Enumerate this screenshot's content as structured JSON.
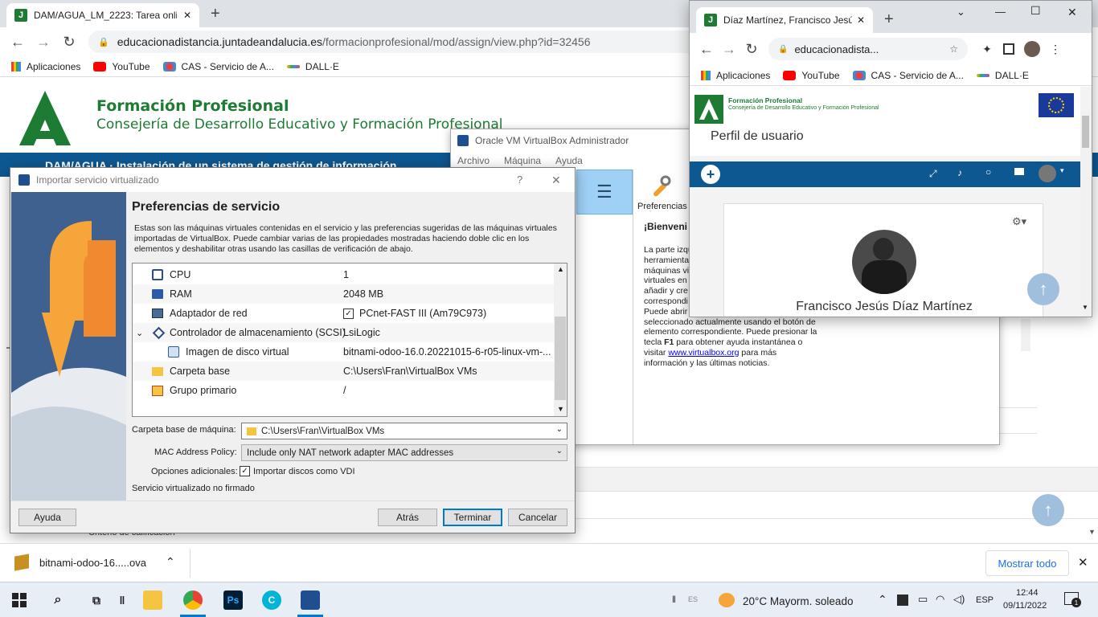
{
  "chrome_main": {
    "tab_title": "DAM/AGUA_LM_2223: Tarea onlin",
    "tab_close": "✕",
    "new_tab": "+",
    "url_host": "educacionadistancia.juntadeandalucia.es",
    "url_path": "/formacionprofesional/mod/assign/view.php?id=32456",
    "bookmarks": [
      "Aplicaciones",
      "YouTube",
      "CAS - Servicio de A...",
      "DALL·E"
    ]
  },
  "page": {
    "title": "Formación Profesional",
    "subtitle": "Consejería de Desarrollo Educativo y Formación Profesional",
    "banner": "DAM/AGUA · Instalación de un sistema de gestión de información",
    "criterio": "Criterio de calificación"
  },
  "vbox_manager": {
    "title": "Oracle VM VirtualBox Administrador",
    "menu": [
      "Archivo",
      "Máquina",
      "Ayuda"
    ],
    "preferences_label": "Preferencias",
    "welcome_heading": "¡Bienveni",
    "welcome_lines": [
      "La parte izqu",
      "herramienta",
      "máquinas vi",
      "virtuales en",
      "añadir y cre",
      "correspondi",
      "Puede abrir"
    ],
    "welcome_full": [
      "seleccionado actualmente usando el botón de",
      "elemento correspondiente. Puede presionar la"
    ],
    "f1_prefix": "tecla ",
    "f1_key": "F1",
    "f1_suffix": " para obtener ayuda instantánea o",
    "visit_prefix": "visitar ",
    "link": "www.virtualbox.org",
    "visit_suffix": " para más",
    "last_line": "información y las últimas noticias."
  },
  "dialog": {
    "title": "Importar servicio virtualizado",
    "help_glyph": "?",
    "close_glyph": "✕",
    "heading": "Preferencias de servicio",
    "description": "Estas son las máquinas virtuales contenidas en el servicio y las preferencias sugeridas de las máquinas virtuales importadas de VirtualBox. Puede cambiar varias de las propiedades mostradas haciendo doble clic en los elementos y deshabilitar otras usando las casillas de verificación de abajo.",
    "rows": [
      {
        "label": "CPU",
        "value": "1",
        "icon": "cpu-icon"
      },
      {
        "label": "RAM",
        "value": "2048 MB",
        "icon": "ram-icon"
      },
      {
        "label": "Adaptador de red",
        "value": "PCnet-FAST III (Am79C973)",
        "icon": "network-icon"
      },
      {
        "label": "Controlador de almacenamiento (SCSI)",
        "value": "LsiLogic",
        "icon": "storage-icon"
      },
      {
        "label": "Imagen de disco virtual",
        "value": "bitnami-odoo-16.0.20221015-6-r05-linux-vm-...",
        "icon": "disk-icon"
      },
      {
        "label": "Carpeta base",
        "value": "C:\\Users\\Fran\\VirtualBox VMs",
        "icon": "folder-icon"
      },
      {
        "label": "Grupo primario",
        "value": "/",
        "icon": "group-icon"
      }
    ],
    "machine_folder_label": "Carpeta base de máquina:",
    "machine_folder_value": "C:\\Users\\Fran\\VirtualBox VMs",
    "mac_policy_label": "MAC Address Policy:",
    "mac_policy_value": "Include only NAT network adapter MAC addresses",
    "additional_label": "Opciones adicionales:",
    "import_vdi_label": "Importar discos como VDI",
    "unsigned": "Servicio virtualizado no firmado",
    "btn_help": "Ayuda",
    "btn_back": "Atrás",
    "btn_finish": "Terminar",
    "btn_cancel": "Cancelar"
  },
  "chrome_second": {
    "tab_title": "Díaz Martínez, Francisco Jesús",
    "tab_close": "✕",
    "new_tab": "+",
    "url": "educacionadista...",
    "bookmarks": [
      "Aplicaciones",
      "YouTube",
      "CAS - Servicio de A...",
      "DALL·E"
    ],
    "fp_title": "Formación Profesional",
    "fp_sub": "Consejería de Desarrollo Educativo y Formación Profesional",
    "page_heading": "Perfil de usuario",
    "profile_name": "Francisco Jesús Díaz Martínez",
    "win_min": "—",
    "win_max": "☐",
    "win_close": "✕"
  },
  "downloads": {
    "file": "bitnami-odoo-16.....ova",
    "show_all": "Mostrar todo",
    "close": "✕"
  },
  "taskbar": {
    "input_lang": "ES",
    "weather": "20°C  Mayorm. soleado",
    "lang": "ESP",
    "time": "12:44",
    "date": "09/11/2022",
    "notifications": "1"
  }
}
